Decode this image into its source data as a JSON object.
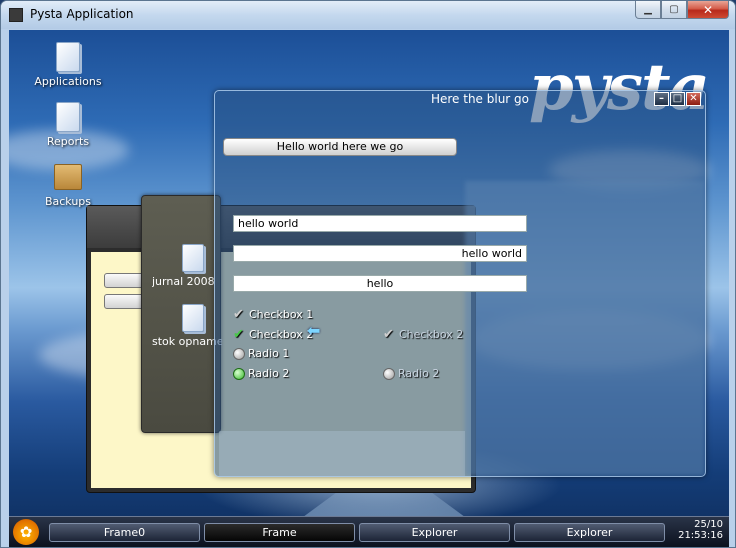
{
  "window": {
    "title": "Pysta Application"
  },
  "desktop": {
    "logo_text": "pysta",
    "icons": [
      {
        "label": "Applications",
        "icon": "folder-document-icon"
      },
      {
        "label": "Reports",
        "icon": "document-icon"
      },
      {
        "label": "Backups",
        "icon": "package-box-icon"
      }
    ]
  },
  "files_window": {
    "items": [
      {
        "label": "jurnal 2008",
        "icon": "document-icon"
      },
      {
        "label": "stok opname",
        "icon": "document-icon"
      }
    ]
  },
  "blur_window": {
    "title": "Here the blur go",
    "button_label": "Hello world here we go",
    "fields": [
      "hello world",
      "hello world",
      "hello"
    ],
    "checkbox1": "Checkbox 1",
    "checkbox2": "Checkbox 2",
    "checkbox2_ghost": "Checkbox 2",
    "radio1": "Radio 1",
    "radio2": "Radio 2",
    "radio2_ghost": "Radio 2",
    "checkbox1_checked": false,
    "checkbox2_checked": true,
    "radio2_selected": true
  },
  "taskbar": {
    "buttons": [
      "Frame0",
      "Frame",
      "Explorer",
      "Explorer"
    ],
    "active_index": 1,
    "clock_date": "25/10",
    "clock_time": "21:53:16"
  },
  "colors": {
    "accent_check": "#4ac94a",
    "title_close": "#c8321f"
  }
}
